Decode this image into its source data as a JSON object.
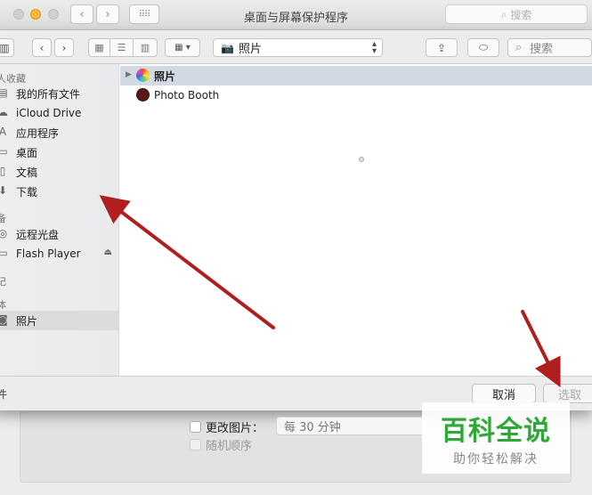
{
  "window": {
    "title": "桌面与屏幕保护程序",
    "search_placeholder": "搜索"
  },
  "toolbar": {
    "location": "照片",
    "search_placeholder": "搜索"
  },
  "sidebar": {
    "sections": [
      {
        "label": "人收藏",
        "items": [
          {
            "label": "我的所有文件",
            "icon": "all-files-icon"
          },
          {
            "label": "iCloud Drive",
            "icon": "cloud-icon"
          },
          {
            "label": "应用程序",
            "icon": "applications-icon"
          },
          {
            "label": "桌面",
            "icon": "desktop-icon"
          },
          {
            "label": "文稿",
            "icon": "documents-icon"
          },
          {
            "label": "下载",
            "icon": "downloads-icon"
          }
        ]
      },
      {
        "label": "备",
        "items": [
          {
            "label": "远程光盘",
            "icon": "disc-icon"
          },
          {
            "label": "Flash Player",
            "icon": "drive-icon"
          }
        ]
      },
      {
        "label": "记",
        "items": []
      },
      {
        "label": "体",
        "items": [
          {
            "label": "照片",
            "icon": "camera-icon"
          }
        ]
      }
    ]
  },
  "files": [
    {
      "label": "照片",
      "icon": "photos-app-icon",
      "selected": true
    },
    {
      "label": "Photo Booth",
      "icon": "photo-booth-icon",
      "selected": false
    }
  ],
  "footer": {
    "cancel_label": "取消",
    "choose_label": "选取",
    "left_fragment": "件"
  },
  "prefs": {
    "change_picture_label": "更改图片：",
    "interval_value": "每 30 分钟",
    "random_order_label": "随机顺序"
  },
  "watermark": {
    "main": "百科全说",
    "sub": "助你轻松解决"
  },
  "colors": {
    "arrow": "#b01e1e",
    "watermark_green": "#2ea836",
    "selection": "#d3d9e3"
  }
}
